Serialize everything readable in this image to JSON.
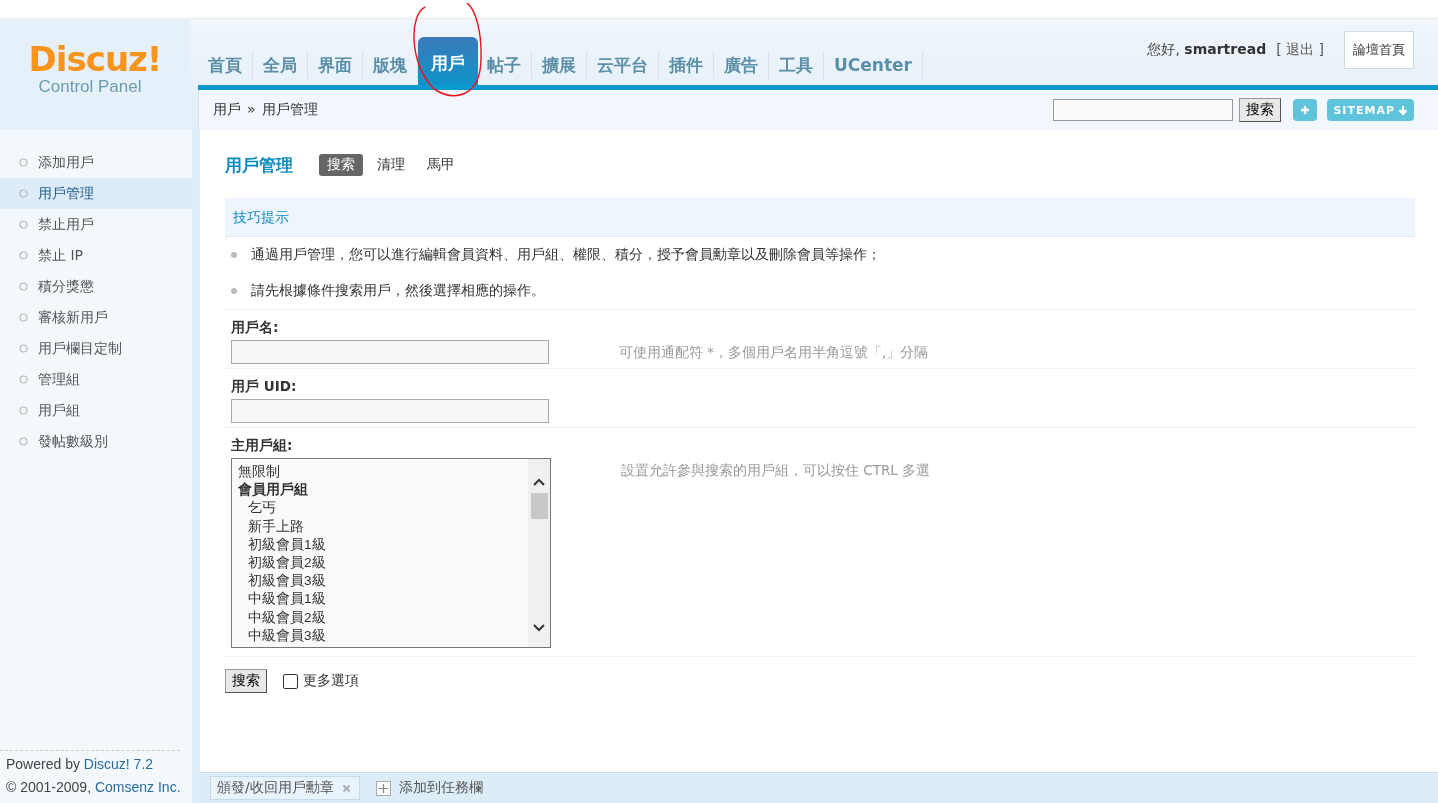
{
  "logo": {
    "name": "Discuz!",
    "subtitle": "Control Panel"
  },
  "nav": [
    {
      "label": "首頁",
      "selected": false
    },
    {
      "label": "全局",
      "selected": false
    },
    {
      "label": "界面",
      "selected": false
    },
    {
      "label": "版塊",
      "selected": false
    },
    {
      "label": "用戶",
      "selected": true
    },
    {
      "label": "帖子",
      "selected": false
    },
    {
      "label": "擴展",
      "selected": false
    },
    {
      "label": "云平台",
      "selected": false
    },
    {
      "label": "插件",
      "selected": false
    },
    {
      "label": "廣告",
      "selected": false
    },
    {
      "label": "工具",
      "selected": false
    },
    {
      "label": "UCenter",
      "selected": false
    }
  ],
  "user": {
    "greeting": "您好,",
    "name": "smartread",
    "logout": "[ 退出 ]",
    "home_button": "論壇首頁"
  },
  "breadcrumb": [
    "用戶",
    "»",
    "用戶管理"
  ],
  "top_search": {
    "button": "搜索",
    "sitemap": "SITEMAP"
  },
  "sidebar": {
    "items": [
      {
        "label": "添加用戶",
        "selected": false
      },
      {
        "label": "用戶管理",
        "selected": true
      },
      {
        "label": "禁止用戶",
        "selected": false
      },
      {
        "label": "禁止 IP",
        "selected": false
      },
      {
        "label": "積分獎懲",
        "selected": false
      },
      {
        "label": "審核新用戶",
        "selected": false
      },
      {
        "label": "用戶欄目定制",
        "selected": false
      },
      {
        "label": "管理組",
        "selected": false
      },
      {
        "label": "用戶組",
        "selected": false
      },
      {
        "label": "發帖數級別",
        "selected": false
      }
    ],
    "footer": {
      "powered_prefix": "Powered by",
      "powered_link": "Discuz! 7.2",
      "copyright_prefix": "© 2001-2009,",
      "copyright_link": "Comsenz Inc."
    }
  },
  "page": {
    "title": "用戶管理",
    "tabs": [
      {
        "label": "搜索",
        "selected": true
      },
      {
        "label": "清理",
        "selected": false
      },
      {
        "label": "馬甲",
        "selected": false
      }
    ]
  },
  "tips": {
    "title": "技巧提示",
    "items": [
      "通過用戶管理，您可以進行編輯會員資料、用戶組、權限、積分，授予會員勳章以及刪除會員等操作；",
      "請先根據條件搜索用戶，然後選擇相應的操作。"
    ]
  },
  "form": {
    "fields": [
      {
        "kind": "text",
        "label": "用戶名:",
        "hint": "可使用通配符 *，多個用戶名用半角逗號「,」分隔"
      },
      {
        "kind": "text",
        "label": "用戶 UID:"
      },
      {
        "kind": "list",
        "label": "主用戶組:",
        "hint": "設置允許參與搜索的用戶組，可以按住 CTRL 多選",
        "options": [
          {
            "label": "無限制",
            "kind": "option"
          },
          {
            "label": "會員用戶組",
            "kind": "group",
            "children": [
              {
                "label": "乞丐"
              },
              {
                "label": "新手上路"
              },
              {
                "label": "初級會員1級"
              },
              {
                "label": "初級會員2級"
              },
              {
                "label": "初級會員3級"
              },
              {
                "label": "中級會員1級"
              },
              {
                "label": "中級會員2級"
              },
              {
                "label": "中級會員3級"
              }
            ]
          }
        ]
      }
    ],
    "submit": "搜索",
    "more_options": {
      "label": "更多選項",
      "checked": false
    }
  },
  "taskbar": {
    "items": [
      {
        "label": "頒發/收回用戶勳章"
      }
    ],
    "add": "添加到任務欄"
  }
}
